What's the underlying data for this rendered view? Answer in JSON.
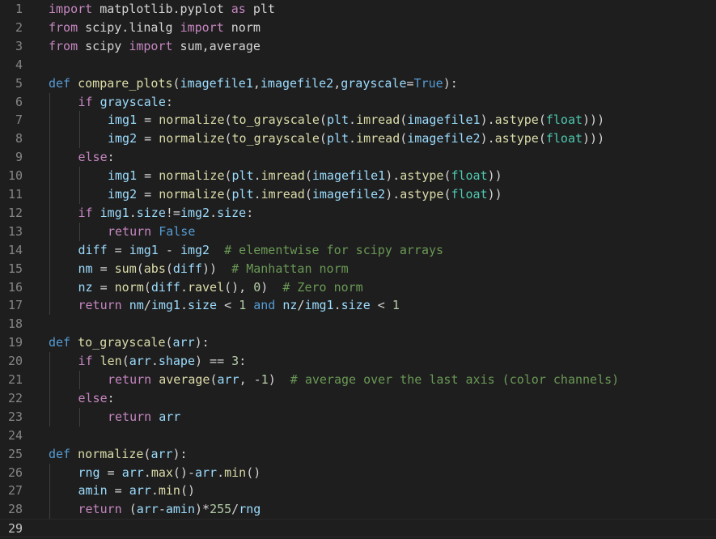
{
  "editor": {
    "current_line": 29,
    "lines": [
      {
        "n": "1",
        "indent": 0,
        "tokens": [
          [
            "kw",
            "import"
          ],
          [
            "txt",
            " matplotlib.pyplot "
          ],
          [
            "kw",
            "as"
          ],
          [
            "txt",
            " plt"
          ]
        ]
      },
      {
        "n": "2",
        "indent": 0,
        "tokens": [
          [
            "kw",
            "from"
          ],
          [
            "txt",
            " scipy.linalg "
          ],
          [
            "kw",
            "import"
          ],
          [
            "txt",
            " norm"
          ]
        ]
      },
      {
        "n": "3",
        "indent": 0,
        "tokens": [
          [
            "kw",
            "from"
          ],
          [
            "txt",
            " scipy "
          ],
          [
            "kw",
            "import"
          ],
          [
            "txt",
            " sum,average"
          ]
        ]
      },
      {
        "n": "4",
        "indent": 0,
        "tokens": []
      },
      {
        "n": "5",
        "indent": 0,
        "tokens": [
          [
            "def",
            "def"
          ],
          [
            "txt",
            " "
          ],
          [
            "fn",
            "compare_plots"
          ],
          [
            "txt",
            "("
          ],
          [
            "var",
            "imagefile1"
          ],
          [
            "txt",
            ","
          ],
          [
            "var",
            "imagefile2"
          ],
          [
            "txt",
            ","
          ],
          [
            "var",
            "grayscale"
          ],
          [
            "txt",
            "="
          ],
          [
            "def",
            "True"
          ],
          [
            "txt",
            "):"
          ]
        ]
      },
      {
        "n": "6",
        "indent": 1,
        "tokens": [
          [
            "kw",
            "if"
          ],
          [
            "txt",
            " "
          ],
          [
            "var",
            "grayscale"
          ],
          [
            "txt",
            ":"
          ]
        ]
      },
      {
        "n": "7",
        "indent": 2,
        "tokens": [
          [
            "var",
            "img1"
          ],
          [
            "txt",
            " = "
          ],
          [
            "fn",
            "normalize"
          ],
          [
            "txt",
            "("
          ],
          [
            "fn",
            "to_grayscale"
          ],
          [
            "txt",
            "("
          ],
          [
            "var",
            "plt"
          ],
          [
            "txt",
            "."
          ],
          [
            "fn",
            "imread"
          ],
          [
            "txt",
            "("
          ],
          [
            "var",
            "imagefile1"
          ],
          [
            "txt",
            ")."
          ],
          [
            "fn",
            "astype"
          ],
          [
            "txt",
            "("
          ],
          [
            "cls",
            "float"
          ],
          [
            "txt",
            ")))"
          ]
        ]
      },
      {
        "n": "8",
        "indent": 2,
        "tokens": [
          [
            "var",
            "img2"
          ],
          [
            "txt",
            " = "
          ],
          [
            "fn",
            "normalize"
          ],
          [
            "txt",
            "("
          ],
          [
            "fn",
            "to_grayscale"
          ],
          [
            "txt",
            "("
          ],
          [
            "var",
            "plt"
          ],
          [
            "txt",
            "."
          ],
          [
            "fn",
            "imread"
          ],
          [
            "txt",
            "("
          ],
          [
            "var",
            "imagefile2"
          ],
          [
            "txt",
            ")."
          ],
          [
            "fn",
            "astype"
          ],
          [
            "txt",
            "("
          ],
          [
            "cls",
            "float"
          ],
          [
            "txt",
            ")))"
          ]
        ]
      },
      {
        "n": "9",
        "indent": 1,
        "tokens": [
          [
            "kw",
            "else"
          ],
          [
            "txt",
            ":"
          ]
        ]
      },
      {
        "n": "10",
        "indent": 2,
        "tokens": [
          [
            "var",
            "img1"
          ],
          [
            "txt",
            " = "
          ],
          [
            "fn",
            "normalize"
          ],
          [
            "txt",
            "("
          ],
          [
            "var",
            "plt"
          ],
          [
            "txt",
            "."
          ],
          [
            "fn",
            "imread"
          ],
          [
            "txt",
            "("
          ],
          [
            "var",
            "imagefile1"
          ],
          [
            "txt",
            ")."
          ],
          [
            "fn",
            "astype"
          ],
          [
            "txt",
            "("
          ],
          [
            "cls",
            "float"
          ],
          [
            "txt",
            "))"
          ]
        ]
      },
      {
        "n": "11",
        "indent": 2,
        "tokens": [
          [
            "var",
            "img2"
          ],
          [
            "txt",
            " = "
          ],
          [
            "fn",
            "normalize"
          ],
          [
            "txt",
            "("
          ],
          [
            "var",
            "plt"
          ],
          [
            "txt",
            "."
          ],
          [
            "fn",
            "imread"
          ],
          [
            "txt",
            "("
          ],
          [
            "var",
            "imagefile2"
          ],
          [
            "txt",
            ")."
          ],
          [
            "fn",
            "astype"
          ],
          [
            "txt",
            "("
          ],
          [
            "cls",
            "float"
          ],
          [
            "txt",
            "))"
          ]
        ]
      },
      {
        "n": "12",
        "indent": 1,
        "tokens": [
          [
            "kw",
            "if"
          ],
          [
            "txt",
            " "
          ],
          [
            "var",
            "img1"
          ],
          [
            "txt",
            "."
          ],
          [
            "var",
            "size"
          ],
          [
            "txt",
            "!="
          ],
          [
            "var",
            "img2"
          ],
          [
            "txt",
            "."
          ],
          [
            "var",
            "size"
          ],
          [
            "txt",
            ":"
          ]
        ]
      },
      {
        "n": "13",
        "indent": 2,
        "tokens": [
          [
            "kw",
            "return"
          ],
          [
            "txt",
            " "
          ],
          [
            "def",
            "False"
          ]
        ]
      },
      {
        "n": "14",
        "indent": 1,
        "tokens": [
          [
            "var",
            "diff"
          ],
          [
            "txt",
            " = "
          ],
          [
            "var",
            "img1"
          ],
          [
            "txt",
            " - "
          ],
          [
            "var",
            "img2"
          ],
          [
            "txt",
            "  "
          ],
          [
            "cmt",
            "# elementwise for scipy arrays"
          ]
        ]
      },
      {
        "n": "15",
        "indent": 1,
        "tokens": [
          [
            "var",
            "nm"
          ],
          [
            "txt",
            " = "
          ],
          [
            "fn",
            "sum"
          ],
          [
            "txt",
            "("
          ],
          [
            "fn",
            "abs"
          ],
          [
            "txt",
            "("
          ],
          [
            "var",
            "diff"
          ],
          [
            "txt",
            "))  "
          ],
          [
            "cmt",
            "# Manhattan norm"
          ]
        ]
      },
      {
        "n": "16",
        "indent": 1,
        "tokens": [
          [
            "var",
            "nz"
          ],
          [
            "txt",
            " = "
          ],
          [
            "fn",
            "norm"
          ],
          [
            "txt",
            "("
          ],
          [
            "var",
            "diff"
          ],
          [
            "txt",
            "."
          ],
          [
            "fn",
            "ravel"
          ],
          [
            "txt",
            "(), "
          ],
          [
            "num",
            "0"
          ],
          [
            "txt",
            ")  "
          ],
          [
            "cmt",
            "# Zero norm"
          ]
        ]
      },
      {
        "n": "17",
        "indent": 1,
        "tokens": [
          [
            "kw",
            "return"
          ],
          [
            "txt",
            " "
          ],
          [
            "var",
            "nm"
          ],
          [
            "txt",
            "/"
          ],
          [
            "var",
            "img1"
          ],
          [
            "txt",
            "."
          ],
          [
            "var",
            "size"
          ],
          [
            "txt",
            " < "
          ],
          [
            "num",
            "1"
          ],
          [
            "txt",
            " "
          ],
          [
            "def",
            "and"
          ],
          [
            "txt",
            " "
          ],
          [
            "var",
            "nz"
          ],
          [
            "txt",
            "/"
          ],
          [
            "var",
            "img1"
          ],
          [
            "txt",
            "."
          ],
          [
            "var",
            "size"
          ],
          [
            "txt",
            " < "
          ],
          [
            "num",
            "1"
          ]
        ]
      },
      {
        "n": "18",
        "indent": 0,
        "tokens": []
      },
      {
        "n": "19",
        "indent": 0,
        "tokens": [
          [
            "def",
            "def"
          ],
          [
            "txt",
            " "
          ],
          [
            "fn",
            "to_grayscale"
          ],
          [
            "txt",
            "("
          ],
          [
            "var",
            "arr"
          ],
          [
            "txt",
            "):"
          ]
        ]
      },
      {
        "n": "20",
        "indent": 1,
        "tokens": [
          [
            "kw",
            "if"
          ],
          [
            "txt",
            " "
          ],
          [
            "fn",
            "len"
          ],
          [
            "txt",
            "("
          ],
          [
            "var",
            "arr"
          ],
          [
            "txt",
            "."
          ],
          [
            "var",
            "shape"
          ],
          [
            "txt",
            ") == "
          ],
          [
            "num",
            "3"
          ],
          [
            "txt",
            ":"
          ]
        ]
      },
      {
        "n": "21",
        "indent": 2,
        "tokens": [
          [
            "kw",
            "return"
          ],
          [
            "txt",
            " "
          ],
          [
            "fn",
            "average"
          ],
          [
            "txt",
            "("
          ],
          [
            "var",
            "arr"
          ],
          [
            "txt",
            ", -"
          ],
          [
            "num",
            "1"
          ],
          [
            "txt",
            ")  "
          ],
          [
            "cmt",
            "# average over the last axis (color channels)"
          ]
        ]
      },
      {
        "n": "22",
        "indent": 1,
        "tokens": [
          [
            "kw",
            "else"
          ],
          [
            "txt",
            ":"
          ]
        ]
      },
      {
        "n": "23",
        "indent": 2,
        "tokens": [
          [
            "kw",
            "return"
          ],
          [
            "txt",
            " "
          ],
          [
            "var",
            "arr"
          ]
        ]
      },
      {
        "n": "24",
        "indent": 0,
        "tokens": []
      },
      {
        "n": "25",
        "indent": 0,
        "tokens": [
          [
            "def",
            "def"
          ],
          [
            "txt",
            " "
          ],
          [
            "fn",
            "normalize"
          ],
          [
            "txt",
            "("
          ],
          [
            "var",
            "arr"
          ],
          [
            "txt",
            "):"
          ]
        ]
      },
      {
        "n": "26",
        "indent": 1,
        "tokens": [
          [
            "var",
            "rng"
          ],
          [
            "txt",
            " = "
          ],
          [
            "var",
            "arr"
          ],
          [
            "txt",
            "."
          ],
          [
            "fn",
            "max"
          ],
          [
            "txt",
            "()-"
          ],
          [
            "var",
            "arr"
          ],
          [
            "txt",
            "."
          ],
          [
            "fn",
            "min"
          ],
          [
            "txt",
            "()"
          ]
        ]
      },
      {
        "n": "27",
        "indent": 1,
        "tokens": [
          [
            "var",
            "amin"
          ],
          [
            "txt",
            " = "
          ],
          [
            "var",
            "arr"
          ],
          [
            "txt",
            "."
          ],
          [
            "fn",
            "min"
          ],
          [
            "txt",
            "()"
          ]
        ]
      },
      {
        "n": "28",
        "indent": 1,
        "tokens": [
          [
            "kw",
            "return"
          ],
          [
            "txt",
            " ("
          ],
          [
            "var",
            "arr"
          ],
          [
            "txt",
            "-"
          ],
          [
            "var",
            "amin"
          ],
          [
            "txt",
            ")*"
          ],
          [
            "num",
            "255"
          ],
          [
            "txt",
            "/"
          ],
          [
            "var",
            "rng"
          ]
        ]
      },
      {
        "n": "29",
        "indent": 0,
        "tokens": []
      }
    ]
  }
}
